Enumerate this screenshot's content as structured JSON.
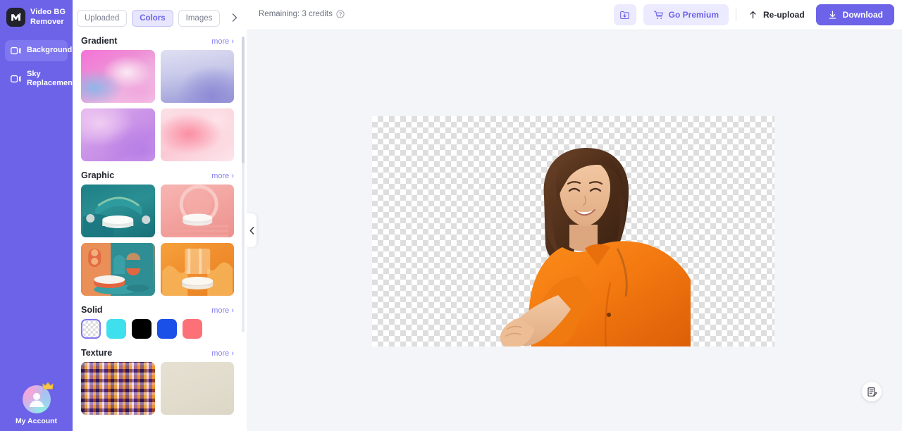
{
  "brand": {
    "name": "Video BG\nRemover",
    "logo_glyph": "M"
  },
  "sidebar": {
    "items": [
      {
        "label": "Background",
        "icon": "video-frame-icon",
        "active": true
      },
      {
        "label": "Sky Replacement",
        "icon": "video-frame-icon",
        "active": false
      }
    ],
    "account_label": "My Account"
  },
  "topbar": {
    "credits_text": "Remaining: 3 credits",
    "help_icon": "question-circle-icon",
    "import_icon": "folder-download-icon",
    "premium_label": "Go Premium",
    "premium_icon": "cart-icon",
    "reupload_label": "Re-upload",
    "reupload_icon": "upload-arrow-icon",
    "download_label": "Download",
    "download_icon": "download-arrow-icon"
  },
  "panel": {
    "tabs": [
      {
        "label": "Uploaded",
        "active": false
      },
      {
        "label": "Colors",
        "active": true
      },
      {
        "label": "Images",
        "active": false
      }
    ],
    "next_icon": "chevron-right-icon",
    "collapse_icon": "chevron-left-icon",
    "more_label": "more",
    "sections": [
      {
        "title": "Gradient",
        "type": "thumbs",
        "items": [
          {
            "name": "gradient-pink-swirl"
          },
          {
            "name": "gradient-periwinkle-waves"
          },
          {
            "name": "gradient-violet-marble"
          },
          {
            "name": "gradient-blush-rose"
          }
        ]
      },
      {
        "title": "Graphic",
        "type": "thumbs",
        "items": [
          {
            "name": "graphic-teal-podium"
          },
          {
            "name": "graphic-pink-podium"
          },
          {
            "name": "graphic-orange-teal-arches"
          },
          {
            "name": "graphic-orange-glass-podium"
          }
        ]
      },
      {
        "title": "Solid",
        "type": "swatches",
        "items": [
          {
            "name": "solid-transparent",
            "color": "transparent",
            "selected": true
          },
          {
            "name": "solid-cyan",
            "color": "#3de0ec",
            "selected": false
          },
          {
            "name": "solid-black",
            "color": "#000000",
            "selected": false
          },
          {
            "name": "solid-blue",
            "color": "#1a4fe8",
            "selected": false
          },
          {
            "name": "solid-coral",
            "color": "#fc7178",
            "selected": false
          }
        ]
      },
      {
        "title": "Texture",
        "type": "thumbs",
        "items": [
          {
            "name": "texture-kaleidoscope"
          },
          {
            "name": "texture-beige-paper"
          }
        ]
      }
    ]
  },
  "canvas": {
    "background": "transparent-checkerboard",
    "subject_alt": "woman-in-orange-shirt"
  },
  "feedback": {
    "icon": "feedback-note-icon"
  },
  "colors": {
    "accent": "#6c63e8",
    "rail": "#6c63e8",
    "rail_active": "#7f77ef",
    "accent_soft": "#eceafe",
    "page_bg": "#f4f5f8"
  }
}
